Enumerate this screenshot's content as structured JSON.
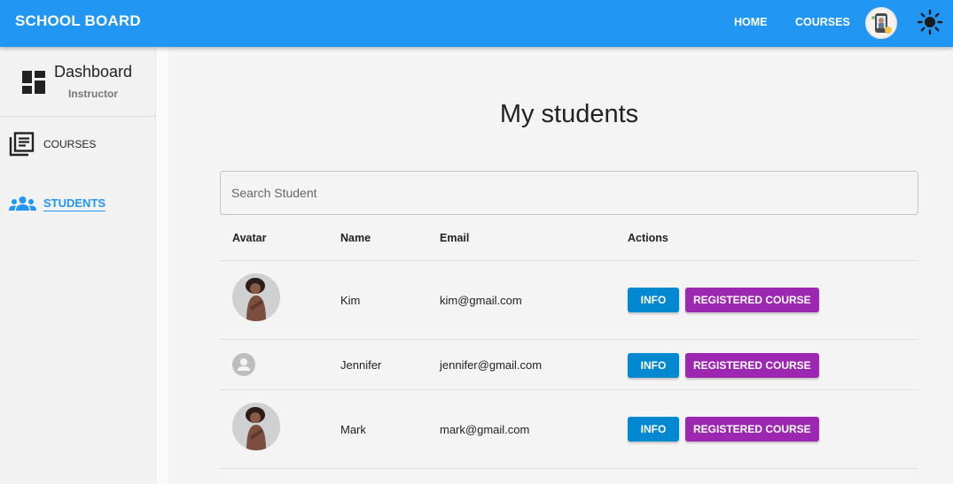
{
  "appbar": {
    "brand": "SCHOOL BOARD",
    "nav": [
      "HOME",
      "COURSES"
    ],
    "color": "#2196f3"
  },
  "sidebar": {
    "title": "Dashboard",
    "subtitle": "Instructor",
    "items": [
      {
        "label": "COURSES",
        "icon": "library-books-icon",
        "active": false
      },
      {
        "label": "STUDENTS",
        "icon": "people-icon",
        "active": true
      }
    ]
  },
  "main": {
    "title": "My students",
    "search": {
      "placeholder": "Search Student",
      "value": ""
    },
    "columns": [
      "Avatar",
      "Name",
      "Email",
      "Actions"
    ],
    "rows": [
      {
        "name": "Kim",
        "email": "kim@gmail.com",
        "avatar": "photo"
      },
      {
        "name": "Jennifer",
        "email": "jennifer@gmail.com",
        "avatar": "default-person-icon"
      },
      {
        "name": "Mark",
        "email": "mark@gmail.com",
        "avatar": "photo"
      }
    ],
    "actions": {
      "info_label": "INFO",
      "registered_label": "REGISTERED COURSE"
    },
    "colors": {
      "info": "#0288d1",
      "registered": "#9c27b0"
    }
  }
}
